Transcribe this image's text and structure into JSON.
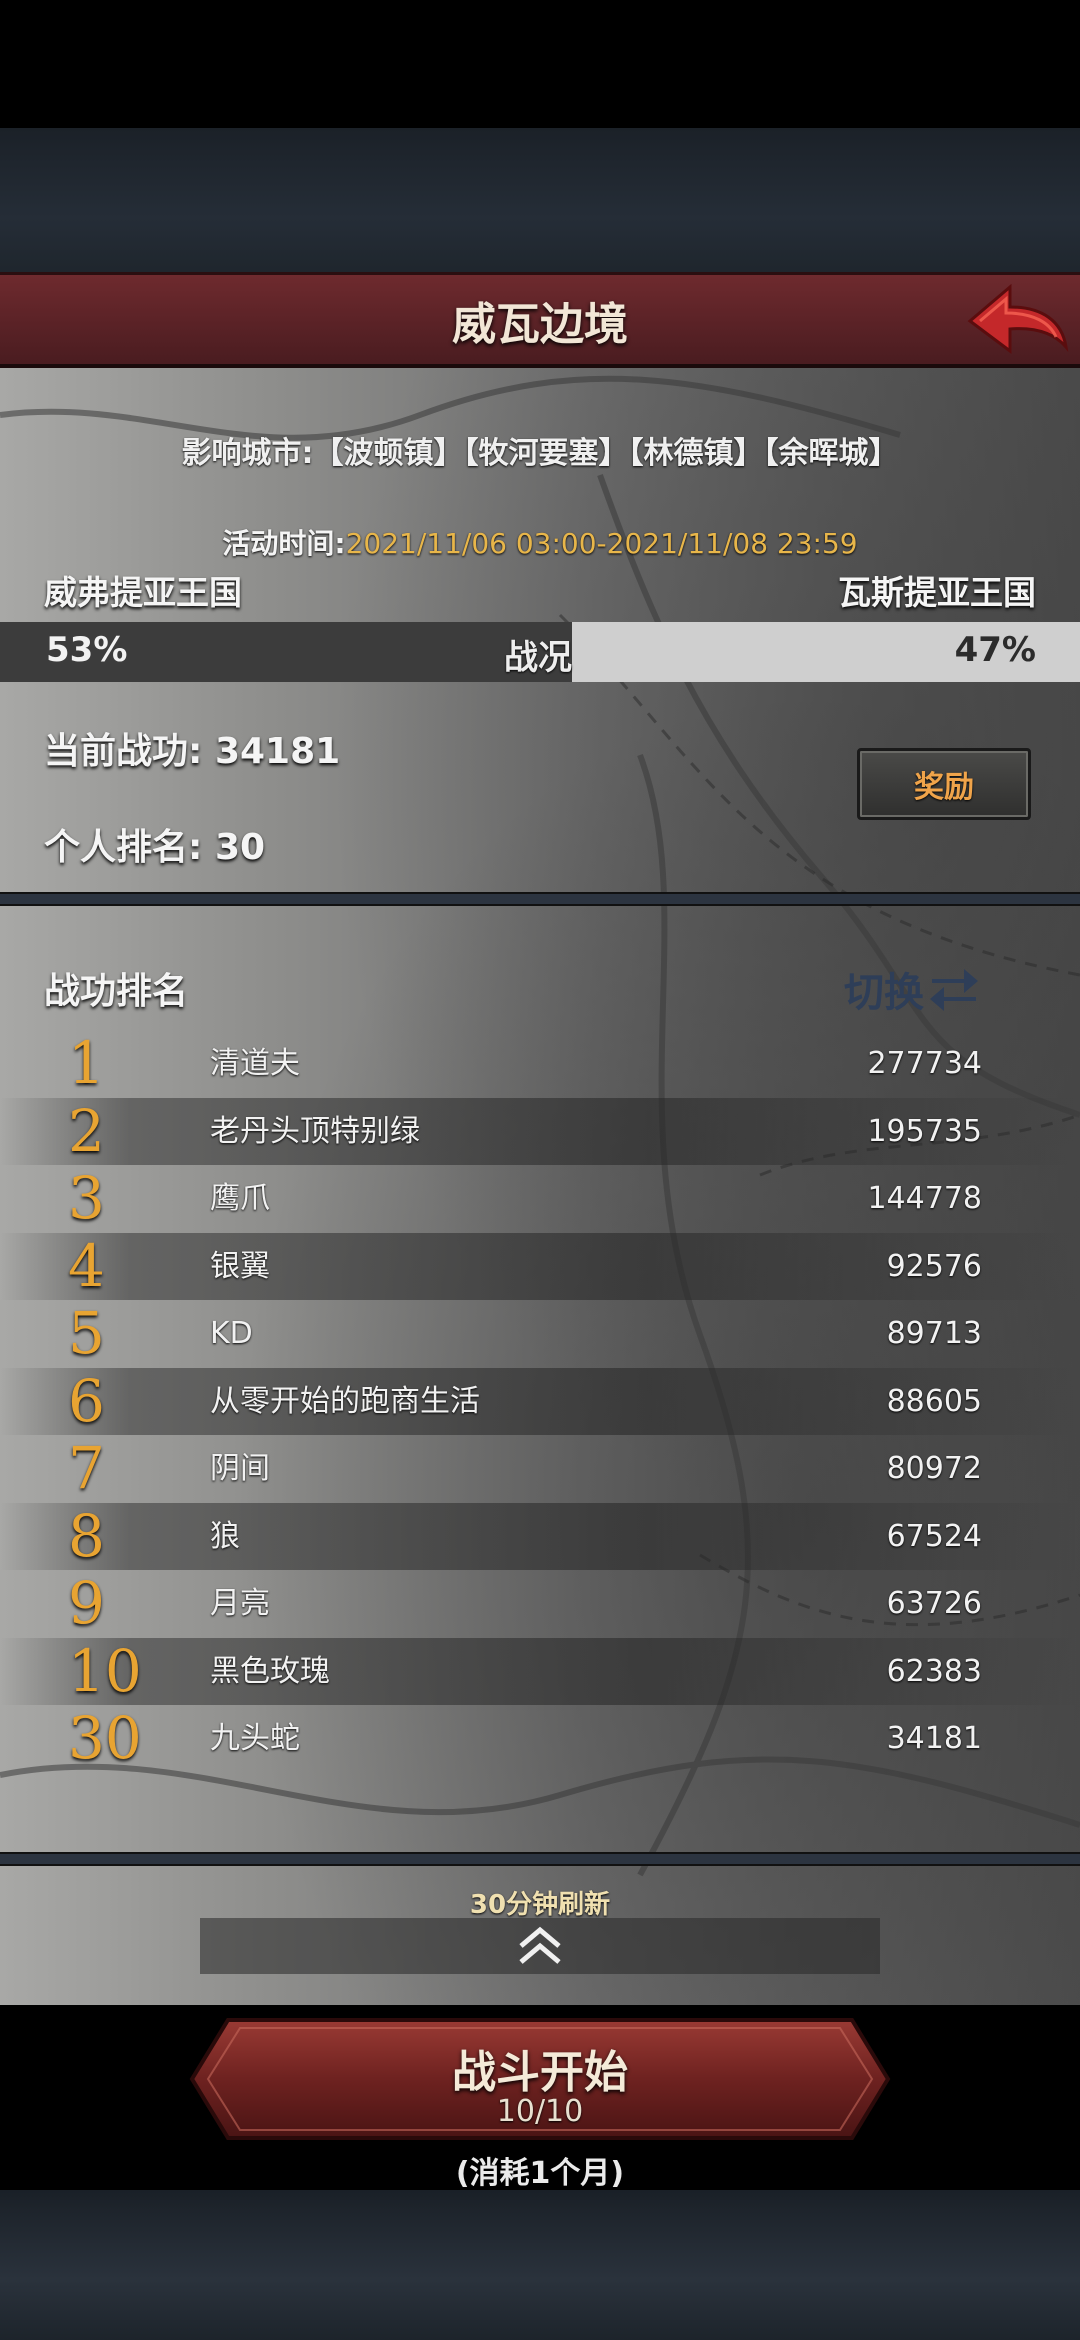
{
  "header": {
    "title": "威瓦边境",
    "back_icon": "back-arrow-icon"
  },
  "info": {
    "cities_label": "影响城市:",
    "cities": "【波顿镇】【牧河要塞】【林德镇】【余晖城】",
    "time_label": "活动时间:",
    "time_value": "2021/11/06 03:00-2021/11/08 23:59"
  },
  "war": {
    "left_faction": "威弗提亚王国",
    "right_faction": "瓦斯提亚王国",
    "left_percent": "53%",
    "right_percent": "47%",
    "left_share": 0.53,
    "center_label": "战况",
    "colors": {
      "left": "#3c3c3c",
      "right": "#cfcfcf"
    }
  },
  "stats": {
    "merit_label": "当前战功:",
    "merit_value": "34181",
    "rank_label": "个人排名:",
    "rank_value": "30",
    "reward_button": "奖励"
  },
  "ranking": {
    "title": "战功排名",
    "switch_label": "切换",
    "rows": [
      {
        "rank": "1",
        "name": "清道夫",
        "score": "277734"
      },
      {
        "rank": "2",
        "name": "老丹头顶特别绿",
        "score": "195735"
      },
      {
        "rank": "3",
        "name": "鹰爪",
        "score": "144778"
      },
      {
        "rank": "4",
        "name": "银翼",
        "score": "92576"
      },
      {
        "rank": "5",
        "name": "KD",
        "score": "89713"
      },
      {
        "rank": "6",
        "name": "从零开始的跑商生活",
        "score": "88605"
      },
      {
        "rank": "7",
        "name": "阴间",
        "score": "80972"
      },
      {
        "rank": "8",
        "name": "狼",
        "score": "67524"
      },
      {
        "rank": "9",
        "name": "月亮",
        "score": "63726"
      },
      {
        "rank": "10",
        "name": "黑色玫瑰",
        "score": "62383"
      },
      {
        "rank": "30",
        "name": "九头蛇",
        "score": "34181"
      }
    ]
  },
  "footer": {
    "refresh_note": "30分钟刷新",
    "battle_label": "战斗开始",
    "battle_count": "10/10",
    "cost_note": "(消耗1个月)",
    "accent": "#e8a432"
  }
}
